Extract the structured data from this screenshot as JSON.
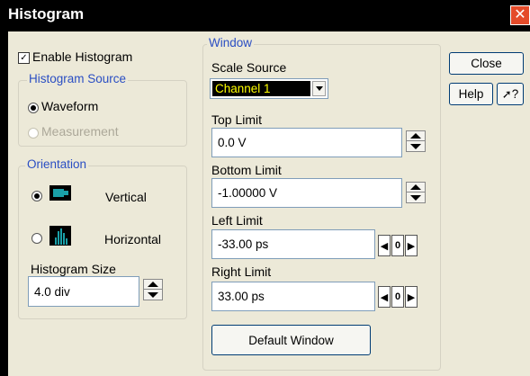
{
  "window": {
    "title": "Histogram",
    "close_glyph": "✕"
  },
  "left": {
    "enable_histogram": {
      "label": "Enable Histogram",
      "checked": true,
      "check_glyph": "✓"
    },
    "source": {
      "legend": "Histogram Source",
      "options": [
        {
          "label": "Waveform",
          "selected": true,
          "enabled": true
        },
        {
          "label": "Measurement",
          "selected": false,
          "enabled": false
        }
      ]
    },
    "orientation": {
      "legend": "Orientation",
      "options": [
        {
          "label": "Vertical",
          "selected": true,
          "icon": "vertical-histogram-icon"
        },
        {
          "label": "Horizontal",
          "selected": false,
          "icon": "horizontal-histogram-icon"
        }
      ]
    },
    "size": {
      "label": "Histogram Size",
      "value": "4.0 div"
    }
  },
  "window_group": {
    "legend": "Window",
    "scale_source": {
      "label": "Scale Source",
      "value": "Channel 1"
    },
    "top_limit": {
      "label": "Top Limit",
      "value": "0.0 V"
    },
    "bottom_limit": {
      "label": "Bottom Limit",
      "value": "-1.00000 V"
    },
    "left_limit": {
      "label": "Left Limit",
      "value": "-33.00 ps",
      "zero_label": "0"
    },
    "right_limit": {
      "label": "Right Limit",
      "value": "33.00 ps",
      "zero_label": "0"
    },
    "default_button": "Default Window"
  },
  "buttons": {
    "close": "Close",
    "help": "Help",
    "whats_this": "?"
  },
  "colors": {
    "legend": "#2a4ec3",
    "scale_source_bg": "#000000",
    "scale_source_text": "#ffff00",
    "histogram_icon": "#1aa0a8"
  }
}
